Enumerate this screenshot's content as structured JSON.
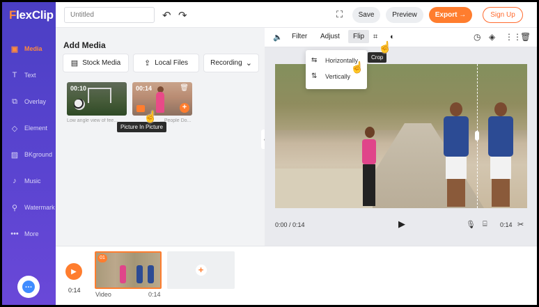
{
  "app": {
    "logo_f": "F",
    "logo_rest": "lexClip"
  },
  "sidebar": {
    "items": [
      {
        "label": "Media",
        "icon": "media-icon"
      },
      {
        "label": "Text",
        "icon": "text-icon"
      },
      {
        "label": "Overlay",
        "icon": "overlay-icon"
      },
      {
        "label": "Element",
        "icon": "element-icon"
      },
      {
        "label": "BKground",
        "icon": "background-icon"
      },
      {
        "label": "Music",
        "icon": "music-icon"
      },
      {
        "label": "Watermark",
        "icon": "watermark-icon"
      },
      {
        "label": "More",
        "icon": "more-icon"
      }
    ]
  },
  "topbar": {
    "title_placeholder": "Untitled",
    "save": "Save",
    "preview": "Preview",
    "export": "Export →",
    "signup": "Sign Up"
  },
  "media": {
    "title": "Add Media",
    "stock": "Stock Media",
    "local": "Local Files",
    "recording": "Recording",
    "thumbs": [
      {
        "duration": "00:10",
        "caption": "Low angle view of fee..."
      },
      {
        "duration": "00:14",
        "caption": "...People Do..."
      }
    ],
    "tooltip": "Picture In Picture"
  },
  "editor": {
    "filter": "Filter",
    "adjust": "Adjust",
    "flip": "Flip",
    "crop_tooltip": "Crop",
    "flip_menu": {
      "horizontal": "Horizontally",
      "vertical": "Vertically"
    },
    "time_current": "0:00 / 0:14",
    "time_total": "0:14"
  },
  "timeline": {
    "time": "0:14",
    "clip_number": "01",
    "clip_label": "Video",
    "clip_duration": "0:14"
  },
  "colors": {
    "accent": "#ff7d2e",
    "sidebar": "#4b3fc4"
  }
}
